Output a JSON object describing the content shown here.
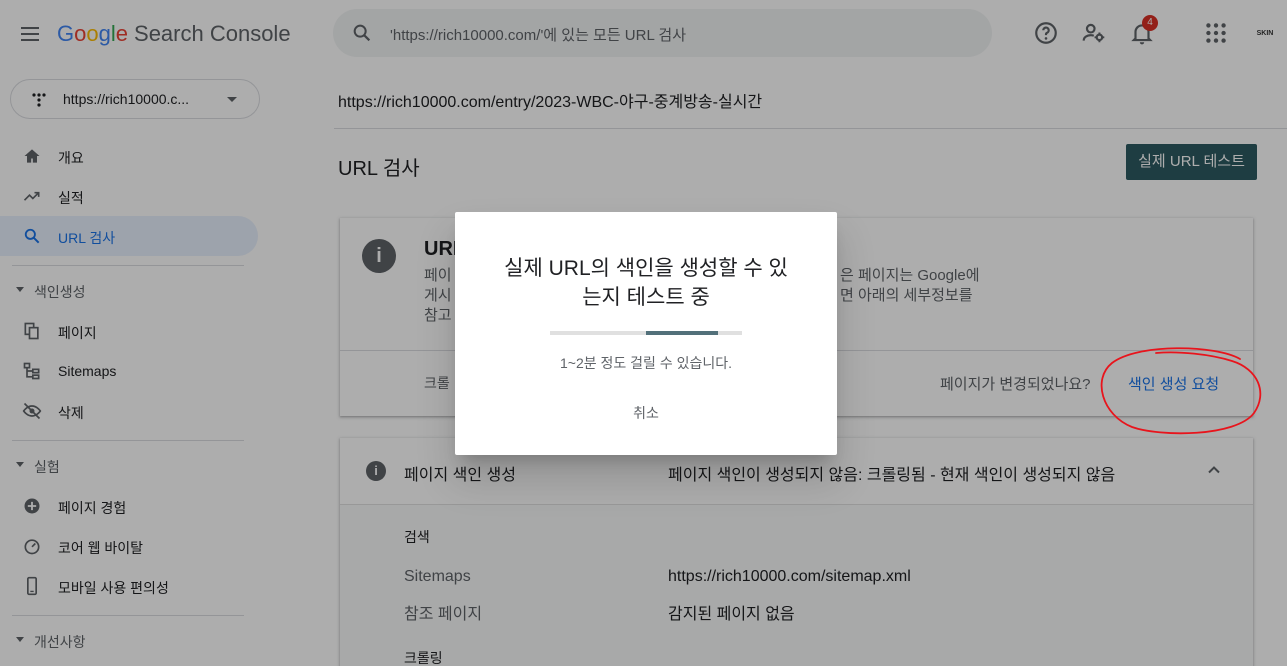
{
  "header": {
    "logo_letters": [
      "G",
      "o",
      "o",
      "g",
      "l",
      "e"
    ],
    "product": "Search Console",
    "search_placeholder": "'https://rich10000.com/'에 있는 모든 URL 검사",
    "notification_count": "4",
    "avatar_text": "SKIN"
  },
  "sidebar": {
    "property": "https://rich10000.c...",
    "items": [
      {
        "label": "개요",
        "icon": "home-icon"
      },
      {
        "label": "실적",
        "icon": "trending-up-icon"
      },
      {
        "label": "URL 검사",
        "icon": "search-icon",
        "active": true
      }
    ],
    "section_indexing": "색인생성",
    "indexing_items": [
      {
        "label": "페이지",
        "icon": "pages-icon"
      },
      {
        "label": "Sitemaps",
        "icon": "sitemap-icon"
      },
      {
        "label": "삭제",
        "icon": "visibility-off-icon"
      }
    ],
    "section_experience": "실험",
    "experience_items": [
      {
        "label": "페이지 경험",
        "icon": "add-circle-icon"
      },
      {
        "label": "코어 웹 바이탈",
        "icon": "speed-icon"
      },
      {
        "label": "모바일 사용 편의성",
        "icon": "smartphone-icon"
      }
    ],
    "section_enhancements": "개선사항"
  },
  "main": {
    "inspected_url": "https://rich10000.com/entry/2023-WBC-야구-중계방송-실시간",
    "title": "URL 검사",
    "live_test_button": "실제 URL 테스트",
    "status_card": {
      "heading": "URL",
      "body_left": [
        "페이",
        "게시",
        "참고"
      ],
      "body_right": [
        "은 페이지는 Google에",
        "면 아래의 세부정보를"
      ],
      "crawl_label": "크롤",
      "changed_question": "페이지가 변경되었나요?",
      "request_indexing": "색인 생성 요청"
    },
    "index_card": {
      "label": "페이지 색인 생성",
      "status": "페이지 색인이 생성되지 않음: 크롤링됨 - 현재 색인이 생성되지 않음",
      "section_discovery": "검색",
      "rows": [
        {
          "key": "Sitemaps",
          "value": "https://rich10000.com/sitemap.xml"
        },
        {
          "key": "참조 페이지",
          "value": "감지된 페이지 없음"
        }
      ],
      "section_crawl": "크롤링"
    }
  },
  "dialog": {
    "title": "실제 URL의 색인을 생성할 수 있는지 테스트 중",
    "title_line1": "실제 URL의 색인을 생성할 수 있",
    "title_line2": "는지 테스트 중",
    "hint": "1~2분 정도 걸릴 수 있습니다.",
    "cancel": "취소",
    "progress_start": 0.5,
    "progress_end": 0.875
  },
  "colors": {
    "accent": "#1a73e8",
    "live_test_button": "#2d5b62",
    "progress": "#52707a",
    "annotation": "#e8141c"
  }
}
